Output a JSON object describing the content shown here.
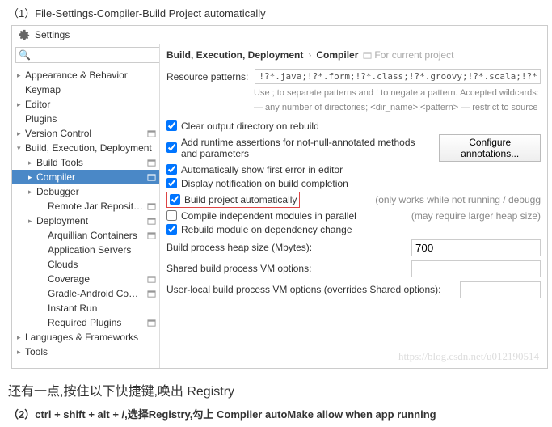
{
  "step1": "（1）File-Settings-Compiler-Build Project automatically",
  "window_title": "Settings",
  "search_placeholder": "",
  "sidebar": {
    "items": [
      {
        "label": "Appearance & Behavior",
        "caret": "▸",
        "indent": 0
      },
      {
        "label": "Keymap",
        "caret": "",
        "indent": 0
      },
      {
        "label": "Editor",
        "caret": "▸",
        "indent": 0
      },
      {
        "label": "Plugins",
        "caret": "",
        "indent": 0
      },
      {
        "label": "Version Control",
        "caret": "▸",
        "indent": 0,
        "proj": true
      },
      {
        "label": "Build, Execution, Deployment",
        "caret": "▾",
        "indent": 0
      },
      {
        "label": "Build Tools",
        "caret": "▸",
        "indent": 1,
        "proj": true
      },
      {
        "label": "Compiler",
        "caret": "▸",
        "indent": 1,
        "proj": true,
        "selected": true
      },
      {
        "label": "Debugger",
        "caret": "▸",
        "indent": 1
      },
      {
        "label": "Remote Jar Repositories",
        "caret": "",
        "indent": 2,
        "proj": true
      },
      {
        "label": "Deployment",
        "caret": "▸",
        "indent": 1,
        "proj": true
      },
      {
        "label": "Arquillian Containers",
        "caret": "",
        "indent": 2,
        "proj": true
      },
      {
        "label": "Application Servers",
        "caret": "",
        "indent": 2
      },
      {
        "label": "Clouds",
        "caret": "",
        "indent": 2
      },
      {
        "label": "Coverage",
        "caret": "",
        "indent": 2,
        "proj": true
      },
      {
        "label": "Gradle-Android Compiler",
        "caret": "",
        "indent": 2,
        "proj": true
      },
      {
        "label": "Instant Run",
        "caret": "",
        "indent": 2
      },
      {
        "label": "Required Plugins",
        "caret": "",
        "indent": 2,
        "proj": true
      },
      {
        "label": "Languages & Frameworks",
        "caret": "▸",
        "indent": 0
      },
      {
        "label": "Tools",
        "caret": "▸",
        "indent": 0
      }
    ]
  },
  "breadcrumb": {
    "a": "Build, Execution, Deployment",
    "b": "Compiler",
    "proj": "For current project"
  },
  "patterns_label": "Resource patterns:",
  "patterns_value": "!?*.java;!?*.form;!?*.class;!?*.groovy;!?*.scala;!?*.flex;!?*.kt;!?*.clj;!?*.aj",
  "hint1": "Use ; to separate patterns and ! to negate a pattern. Accepted wildcards: ? — exactly one sym",
  "hint2": "— any number of directories; <dir_name>:<pattern> — restrict to source roots with the spec",
  "checks": [
    {
      "label": "Clear output directory on rebuild",
      "checked": true
    },
    {
      "label": "Add runtime assertions for not-null-annotated methods and parameters",
      "checked": true,
      "btn": "Configure annotations..."
    },
    {
      "label": "Automatically show first error in editor",
      "checked": true
    },
    {
      "label": "Display notification on build completion",
      "checked": true
    },
    {
      "label": "Build project automatically",
      "checked": true,
      "highlight": true,
      "trail": "(only works while not running / debugg"
    },
    {
      "label": "Compile independent modules in parallel",
      "checked": false,
      "trail": "(may require larger heap size)"
    },
    {
      "label": "Rebuild module on dependency change",
      "checked": true
    }
  ],
  "heap_label": "Build process heap size (Mbytes):",
  "heap_value": "700",
  "shared_vm_label": "Shared build process VM options:",
  "shared_vm_value": "",
  "user_vm_label": "User-local build process VM options (overrides Shared options):",
  "user_vm_value": "",
  "watermark": "https://blog.csdn.net/u012190514",
  "note": "还有一点,按住以下快捷键,唤出 Registry",
  "step2": "（2）ctrl + shift + alt + /,选择Registry,勾上 Compiler autoMake allow when app running"
}
